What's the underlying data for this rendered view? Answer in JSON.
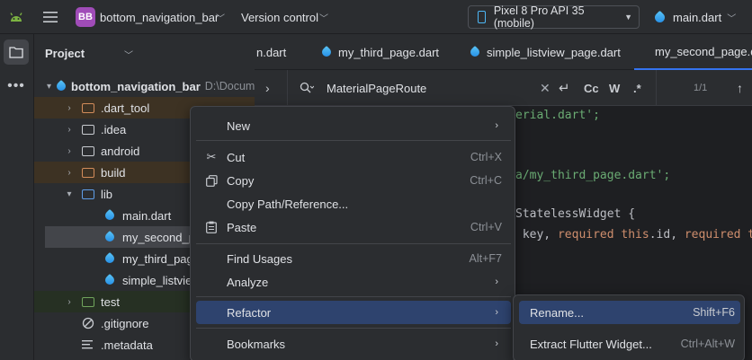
{
  "titlebar": {
    "project_badge": "BB",
    "project_name": "bottom_navigation_bar",
    "vcs_label": "Version control",
    "device": "Pixel 8 Pro API 35 (mobile)",
    "run_config": "main.dart"
  },
  "project_panel": {
    "title": "Project",
    "root_name": "bottom_navigation_bar",
    "root_path": "D:\\Docum",
    "items": [
      {
        "label": ".dart_tool"
      },
      {
        "label": ".idea"
      },
      {
        "label": "android"
      },
      {
        "label": "build"
      },
      {
        "label": "lib"
      },
      {
        "label": "main.dart"
      },
      {
        "label": "my_second_pag"
      },
      {
        "label": "my_third_page."
      },
      {
        "label": "simple_listview_"
      },
      {
        "label": "test"
      },
      {
        "label": ".gitignore"
      },
      {
        "label": ".metadata"
      }
    ]
  },
  "tabs": [
    {
      "label": "n.dart"
    },
    {
      "label": "my_third_page.dart"
    },
    {
      "label": "simple_listview_page.dart"
    },
    {
      "label": "my_second_page.d"
    }
  ],
  "search": {
    "query": "MaterialPageRoute",
    "cc": "Cc",
    "w": "W",
    "regex": ".*",
    "count": "1/1"
  },
  "code_lines": {
    "l1": "erial.dart';",
    "l2": "a/my_third_page.dart';",
    "l3a": "StatelessWidget {",
    "l4a": " key, ",
    "l4b": "required this",
    "l4c": ".id, ",
    "l4d": "required t"
  },
  "context_menu": {
    "new": "New",
    "cut": "Cut",
    "cut_short": "Ctrl+X",
    "copy": "Copy",
    "copy_short": "Ctrl+C",
    "copy_path": "Copy Path/Reference...",
    "paste": "Paste",
    "paste_short": "Ctrl+V",
    "find_usages": "Find Usages",
    "find_usages_short": "Alt+F7",
    "analyze": "Analyze",
    "refactor": "Refactor",
    "bookmarks": "Bookmarks"
  },
  "refactor_submenu": {
    "rename": "Rename...",
    "rename_short": "Shift+F6",
    "extract_widget": "Extract Flutter Widget...",
    "extract_widget_short": "Ctrl+Alt+W"
  },
  "colors": {
    "accent": "#3574f0",
    "highlight": "#2e436e",
    "string": "#6aab73",
    "keyword": "#cf8e6d"
  }
}
